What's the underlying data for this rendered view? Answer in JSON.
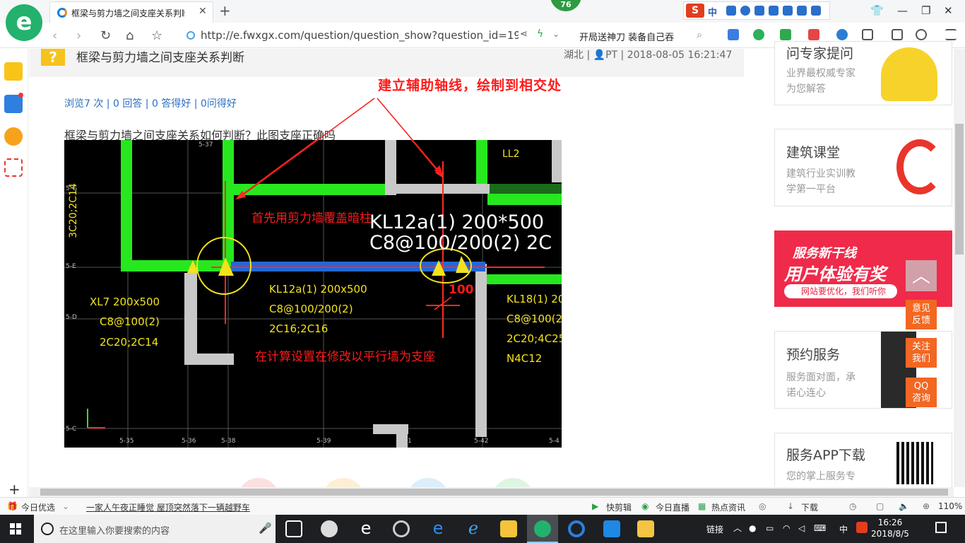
{
  "browser": {
    "tab_title": "框梁与剪力墙之间支座关系判断_",
    "badge_count": "76",
    "url": "http://e.fwxgx.com/question/question_show?question_id=19",
    "ad_text": "开局送神刀 装备自己吞",
    "sogou_label": "中"
  },
  "question": {
    "title": "框梁与剪力墙之间支座关系判断",
    "location": "湖北",
    "author": "PT",
    "datetime": "2018-08-05 16:21:47",
    "stats": "浏览7 次 | 0 回答 | 0 答得好 | 0问得好",
    "description": "框梁与剪力墙之间支座关系如何判断？此图支座正确吗"
  },
  "cad": {
    "annotation_top": "建立辅助轴线，绘制到相交处",
    "annotation_mid": "首先用剪力墙覆盖暗柱",
    "annotation_bottom": "在计算设置在修改以平行墙为支座",
    "dim_100": "100",
    "kl12_big_1": "KL12a(1) 200*500",
    "kl12_big_2": "C8@100/200(2) 2C",
    "ll2": "LL2",
    "vert_label": "3C20;2C14",
    "xl7_1": "XL7 200x500",
    "xl7_2": "C8@100(2)",
    "xl7_3": "2C20;2C14",
    "kl12_1": "KL12a(1) 200x500",
    "kl12_2": "C8@100/200(2)",
    "kl12_3": "2C16;2C16",
    "kl18_1": "KL18(1) 20",
    "kl18_2": "C8@100(2",
    "kl18_3": "2C20;4C25",
    "kl18_4": "N4C12",
    "axis_x": [
      "5-35",
      "5-36",
      "5-38",
      "5-39",
      "1",
      "5-42",
      "5-4"
    ],
    "axis_top": [
      "5-37",
      "LL2"
    ],
    "axis_y": [
      "5-G",
      "5-E",
      "5-D",
      "5-C"
    ]
  },
  "right_cards": [
    {
      "title": "问专家提问",
      "sub1": "业界最权威专家",
      "sub2": "为您解答"
    },
    {
      "title": "建筑课堂",
      "sub1": "建筑行业实训教",
      "sub2": "学第一平台"
    },
    {
      "title": "预约服务",
      "sub1": "服务面对面，承",
      "sub2": "诺心连心"
    },
    {
      "title": "服务APP下载",
      "sub1": "您的掌上服务专",
      "sub2": ""
    }
  ],
  "banner": {
    "line1": "服务新干线",
    "line2": "用户体验有奖",
    "line3": "网站要优化，我们听你"
  },
  "float_buttons": [
    "意见\n反馈",
    "关注\n我们",
    "QQ\n咨询"
  ],
  "statusbar": {
    "today": "今日优选",
    "news": "一家人午夜正睡觉 屋顶突然落下一辆越野车",
    "kuaijian": "快剪辑",
    "live": "今日直播",
    "hot": "热点资讯",
    "download": "下载",
    "zoom": "110%"
  },
  "taskbar": {
    "search_placeholder": "在这里输入你要搜索的内容",
    "tray_link": "链接",
    "ime": "中",
    "time": "16:26",
    "date": "2018/8/5"
  },
  "colors": {
    "accent_green": "#23b26d",
    "wall_green": "#27e81f",
    "annotation_red": "#ff1a1a",
    "cad_yellow": "#f3e21c",
    "link_blue": "#2c6fbf",
    "float_orange": "#f26722"
  }
}
